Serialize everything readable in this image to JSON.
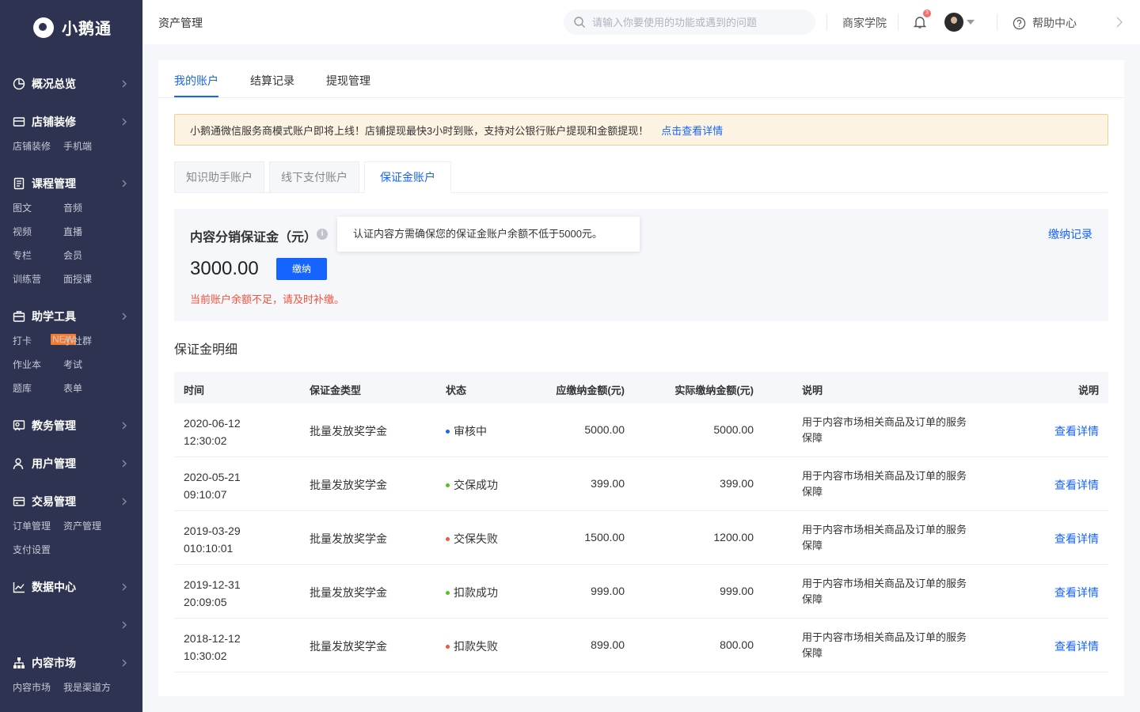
{
  "app": {
    "name": "小鹅通"
  },
  "sidebar": {
    "groups": [
      {
        "label": "概况总览",
        "icon": "overview-icon",
        "sub": []
      },
      {
        "label": "店铺装修",
        "icon": "shop-icon",
        "sub": [
          "店铺装修",
          "手机端"
        ]
      },
      {
        "label": "课程管理",
        "icon": "course-icon",
        "sub": [
          "图文",
          "音频",
          "视频",
          "直播",
          "专栏",
          "会员",
          "训练营",
          "面授课"
        ]
      },
      {
        "label": "助学工具",
        "icon": "toolbox-icon",
        "sub": [
          "打卡",
          "小社群",
          "作业本",
          "考试",
          "题库",
          "表单"
        ],
        "badge": "NEW"
      },
      {
        "label": "教务管理",
        "icon": "academic-icon",
        "sub": []
      },
      {
        "label": "用户管理",
        "icon": "user-icon",
        "sub": []
      },
      {
        "label": "交易管理",
        "icon": "trade-icon",
        "sub": [
          "订单管理",
          "资产管理",
          "支付设置"
        ]
      },
      {
        "label": "数据中心",
        "icon": "data-icon",
        "sub": []
      },
      {
        "label": "",
        "icon": "",
        "sub": []
      },
      {
        "label": "内容市场",
        "icon": "market-icon",
        "sub": [
          "内容市场",
          "我是渠道方"
        ]
      }
    ]
  },
  "topbar": {
    "title": "资产管理",
    "search_placeholder": "请输入你要使用的功能或遇到的问题",
    "academy": "商家学院",
    "bell_count": "3",
    "help": "帮助中心"
  },
  "tabs": [
    "我的账户",
    "结算记录",
    "提现管理"
  ],
  "notice": {
    "text": "小鹅通微信服务商模式账户即将上线！店铺提现最快3小时到账，支持对公银行账户提现和金额提现！",
    "link": "点击查看详情"
  },
  "subtabs": [
    "知识助手账户",
    "线下支付账户",
    "保证金账户"
  ],
  "deposit": {
    "title": "内容分销保证金（元）",
    "info": "i",
    "tooltip": "认证内容方需确保您的保证金账户余额不低于5000元。",
    "amount": "3000.00",
    "pay_button": "缴纳",
    "warning": "当前账户余额不足，请及时补缴。",
    "record_link": "缴纳记录"
  },
  "detail": {
    "title": "保证金明细",
    "columns": [
      "时间",
      "保证金类型",
      "状态",
      "应缴纳金额(元)",
      "实际缴纳金额(元)",
      "说明",
      "说明"
    ],
    "rows": [
      {
        "date": "2020-06-12",
        "time": "12:30:02",
        "type": "批量发放奖学金",
        "status": "审核中",
        "status_color": "#1664ff",
        "due": "5000.00",
        "paid": "5000.00",
        "desc": "用于内容市场相关商品及订单的服务保障",
        "action": "查看详情"
      },
      {
        "date": "2020-05-21",
        "time": "09:10:07",
        "type": "批量发放奖学金",
        "status": "交保成功",
        "status_color": "#52c41a",
        "due": "399.00",
        "paid": "399.00",
        "desc": "用于内容市场相关商品及订单的服务保障",
        "action": "查看详情"
      },
      {
        "date": "2019-03-29",
        "time": "010:10:01",
        "type": "批量发放奖学金",
        "status": "交保失败",
        "status_color": "#f5533d",
        "due": "1500.00",
        "paid": "1200.00",
        "desc": "用于内容市场相关商品及订单的服务保障",
        "action": "查看详情"
      },
      {
        "date": "2019-12-31",
        "time": "20:09:05",
        "type": "批量发放奖学金",
        "status": "扣款成功",
        "status_color": "#52c41a",
        "due": "999.00",
        "paid": "999.00",
        "desc": "用于内容市场相关商品及订单的服务保障",
        "action": "查看详情"
      },
      {
        "date": "2018-12-12",
        "time": "10:30:02",
        "type": "批量发放奖学金",
        "status": "扣款失败",
        "status_color": "#f5533d",
        "due": "899.00",
        "paid": "800.00",
        "desc": "用于内容市场相关商品及订单的服务保障",
        "action": "查看详情"
      }
    ]
  },
  "colors": {
    "primary": "#1664ff",
    "sidebar": "#2d3350",
    "warning": "#f5533d"
  }
}
